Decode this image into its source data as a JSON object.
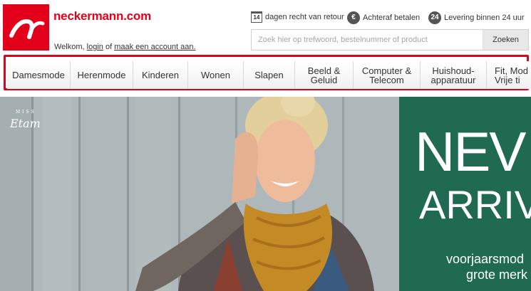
{
  "header": {
    "brand": "neckermann.com",
    "welcome_prefix": "Welkom,",
    "login_label": "login",
    "welcome_of": "of",
    "signup_label": "maak een account aan.",
    "usps": [
      {
        "icon": "calendar-icon",
        "icon_text": "14",
        "label": "dagen recht van retour"
      },
      {
        "icon": "euro-icon",
        "icon_text": "€",
        "label": "Achteraf betalen"
      },
      {
        "icon": "24h-icon",
        "icon_text": "24",
        "label": "Levering binnen 24 uur"
      }
    ],
    "search": {
      "placeholder": "Zoek hier op trefwoord, bestelnummer of product",
      "button_label": "Zoeken"
    }
  },
  "nav": {
    "items": [
      {
        "line1": "Damesmode",
        "line2": ""
      },
      {
        "line1": "Herenmode",
        "line2": ""
      },
      {
        "line1": "Kinderen",
        "line2": ""
      },
      {
        "line1": "Wonen",
        "line2": ""
      },
      {
        "line1": "Slapen",
        "line2": ""
      },
      {
        "line1": "Beeld &",
        "line2": "Geluid"
      },
      {
        "line1": "Computer &",
        "line2": "Telecom"
      },
      {
        "line1": "Huishoud-",
        "line2": "apparatuur"
      },
      {
        "line1": "Fit, Mod",
        "line2": "Vrije ti"
      }
    ]
  },
  "hero": {
    "brand_small": "MISS",
    "brand": "Etam",
    "headline1": "NEV",
    "headline2": "ARRIV",
    "sub1": "voorjaarsmod",
    "sub2": "grote merk",
    "colors": {
      "panel": "#1f6a50",
      "brand_red": "#e2001a"
    }
  }
}
